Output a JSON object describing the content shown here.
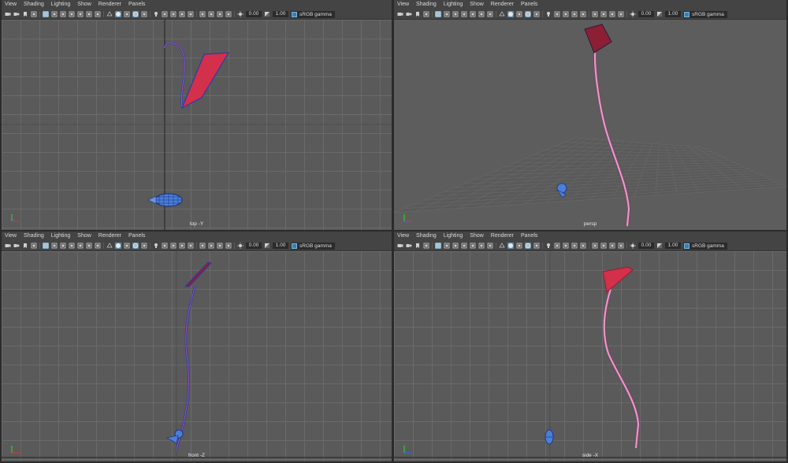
{
  "menu": [
    "View",
    "Shading",
    "Lighting",
    "Show",
    "Renderer",
    "Panels"
  ],
  "toolbar": {
    "exposure": "0.00",
    "gamma": "1.00",
    "color_space": "sRGB gamma"
  },
  "viewports": [
    {
      "id": "top",
      "label": "top -Y"
    },
    {
      "id": "persp",
      "label": "persp"
    },
    {
      "id": "front",
      "label": "front -Z"
    },
    {
      "id": "side",
      "label": "side -X"
    }
  ],
  "colors": {
    "kite_face": "#d2304b",
    "kite_dark": "#8c1f34",
    "tail": "#e89ac6",
    "wire": "#2d3aa8",
    "bird": "#4b7fd8",
    "active_border": "#cfcfcf"
  }
}
